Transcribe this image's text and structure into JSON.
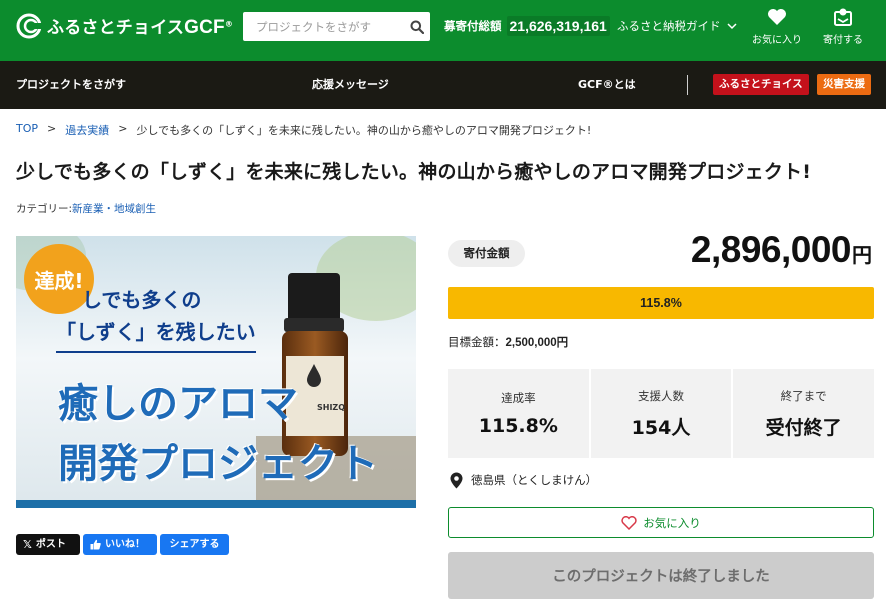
{
  "header": {
    "logo_text": "ふるさとチョイス",
    "logo_gcf": "GCF",
    "logo_reg": "®",
    "search_placeholder": "プロジェクトをさがす",
    "total_label": "募寄付総額",
    "total_value": "21,626,319,161",
    "guide_label": "ふるさと納税ガイド",
    "favorites_label": "お気に入り",
    "donate_label": "寄付する",
    "brand_color": "#0c8c2d"
  },
  "nav": {
    "items": [
      "プロジェクトをさがす",
      "応援メッセージ",
      "GCF®とは"
    ],
    "choice_button": "ふるさとチョイス",
    "disaster_button": "災害支援",
    "choice_color": "#c4111b",
    "disaster_color": "#ec6b12"
  },
  "breadcrumb": {
    "items": [
      "TOP",
      "過去実績"
    ],
    "separator": ">",
    "current": "少しでも多くの「しずく」を未来に残したい。神の山から癒やしのアロマ開発プロジェクト!"
  },
  "project": {
    "title": "少しでも多くの「しずく」を未来に残したい。神の山から癒やしのアロマ開発プロジェクト!",
    "category_label": "カテゴリー:",
    "category_value": "新産業・地域創生",
    "hero": {
      "badge": "達成!",
      "line1": "しでも多くの",
      "line2": "「しずく」を残したい",
      "big1": "癒しのアロマ",
      "big2": "開発プロジェクト",
      "brand": "SHIZQ"
    }
  },
  "share": {
    "x_label": "ポスト",
    "like_label": "いいね！",
    "share_label": "シェアする"
  },
  "funding": {
    "amount_label": "寄付金額",
    "amount_value": "2,896,000",
    "amount_unit": "円",
    "progress_percent": 115.8,
    "progress_text": "115.8%",
    "progress_color": "#f8b800",
    "target_label": "目標金額：",
    "target_value": "2,500,000円",
    "stats": [
      {
        "label": "達成率",
        "value": "115.8%"
      },
      {
        "label": "支援人数",
        "value": "154人"
      },
      {
        "label": "終了まで",
        "value": "受付終了"
      }
    ],
    "location": "徳島県（とくしまけん）",
    "favorite_button": "お気に入り",
    "ended_button": "このプロジェクトは終了しました"
  }
}
